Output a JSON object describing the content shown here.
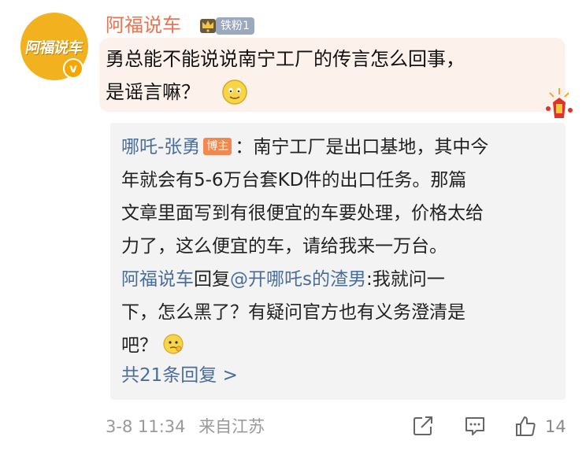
{
  "user": {
    "avatar_text": "阿福说车",
    "verified_mark": "v",
    "name": "阿福说车",
    "fan_badge": "铁粉1"
  },
  "comment": {
    "line1": "勇总能不能说说南宁工厂的传言怎么回事，",
    "line2": "是谣言嘛？"
  },
  "reply_box": {
    "author": "哪吒-张勇",
    "author_tag": "博主",
    "text_line1": "：南宁工厂是出口基地，其中今",
    "text_line2": "年就会有5-6万台套KD件的出口任务。那篇",
    "text_line3": "文章里面写到有很便宜的车要处理，价格太给",
    "text_line4": "力了，这么便宜的车，请给我来一万台。",
    "reply_author": "阿福说车",
    "reply_verb": "回复",
    "reply_target": "@开哪吒s的渣男",
    "reply_line1": ":我就问一",
    "reply_line2": "下，怎么黑了？有疑问官方也有义务澄清是",
    "reply_line3": "吧？",
    "more_replies": "共21条回复 >"
  },
  "meta": {
    "date": "3-8 11:34",
    "source": "来自江苏"
  },
  "actions": {
    "like_count": "14"
  },
  "colors": {
    "username": "#eb7350",
    "link_blue": "#4b6d9a",
    "bubble_bg": "#fdf1ec",
    "reply_bg": "#f3f3f3",
    "avatar_bg": "#f2b21f"
  },
  "icons": [
    "crown-icon",
    "smile-emoji-icon",
    "fireworks-icon",
    "think-emoji-icon",
    "share-icon",
    "comment-icon",
    "like-icon"
  ]
}
